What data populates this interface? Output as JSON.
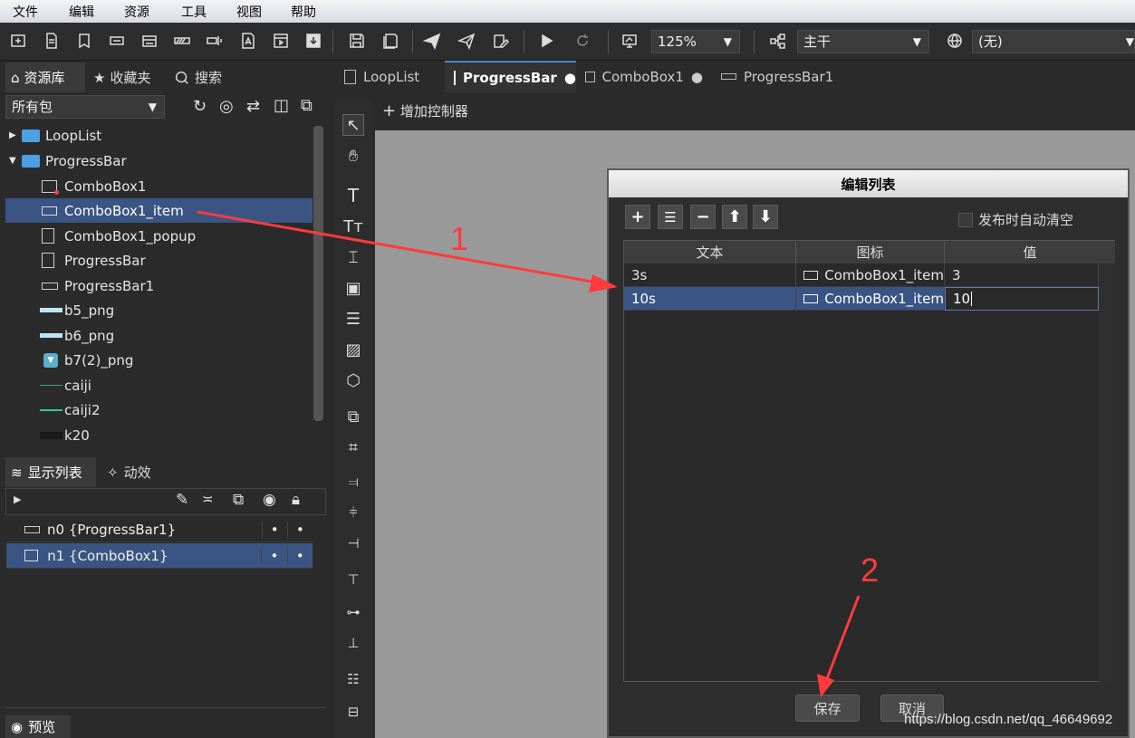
{
  "menu": [
    "文件",
    "编辑",
    "资源",
    "工具",
    "视图",
    "帮助"
  ],
  "toolbar": {
    "zoom": "125%",
    "branch": "主干",
    "language": "(无)"
  },
  "left_tabs": {
    "library": "资源库",
    "favorites": "收藏夹",
    "search": "搜索"
  },
  "package_filter": "所有包",
  "tree": [
    {
      "label": "LoopList",
      "kind": "package"
    },
    {
      "label": "ProgressBar",
      "kind": "package"
    },
    {
      "label": "ComboBox1",
      "kind": "combo"
    },
    {
      "label": "ComboBox1_item",
      "kind": "button"
    },
    {
      "label": "ComboBox1_popup",
      "kind": "doc"
    },
    {
      "label": "ProgressBar",
      "kind": "doc"
    },
    {
      "label": "ProgressBar1",
      "kind": "progress"
    },
    {
      "label": "b5_png",
      "kind": "image"
    },
    {
      "label": "b6_png",
      "kind": "image"
    },
    {
      "label": "b7(2)_png",
      "kind": "image"
    },
    {
      "label": "caiji",
      "kind": "line"
    },
    {
      "label": "caiji2",
      "kind": "line"
    },
    {
      "label": "k20",
      "kind": "dark"
    }
  ],
  "display_tabs": {
    "list": "显示列表",
    "effects": "动效"
  },
  "display_list": [
    {
      "label": "n0 {ProgressBar1}",
      "selected": false
    },
    {
      "label": "n1 {ComboBox1}",
      "selected": true
    }
  ],
  "preview": "预览",
  "doc_tabs": [
    {
      "label": "LoopList",
      "modified": false
    },
    {
      "label": "ProgressBar",
      "modified": true
    },
    {
      "label": "ComboBox1",
      "modified": true
    },
    {
      "label": "ProgressBar1",
      "modified": false
    }
  ],
  "add_controller": "增加控制器",
  "dialog": {
    "title": "编辑列表",
    "auto_clear": "发布时自动清空",
    "columns": [
      "文本",
      "图标",
      "值"
    ],
    "rows": [
      {
        "text": "3s",
        "icon": "ComboBox1_item",
        "value": "3"
      },
      {
        "text": "10s",
        "icon": "ComboBox1_item",
        "value": "10"
      }
    ],
    "save": "保存",
    "cancel": "取消"
  },
  "annotations": {
    "one": "1",
    "two": "2"
  },
  "watermark": "https://blog.csdn.net/qq_46649692",
  "colors": {
    "selection": "#3a5583",
    "annotation": "#ff3b3b",
    "accent": "#4a8ad0"
  }
}
